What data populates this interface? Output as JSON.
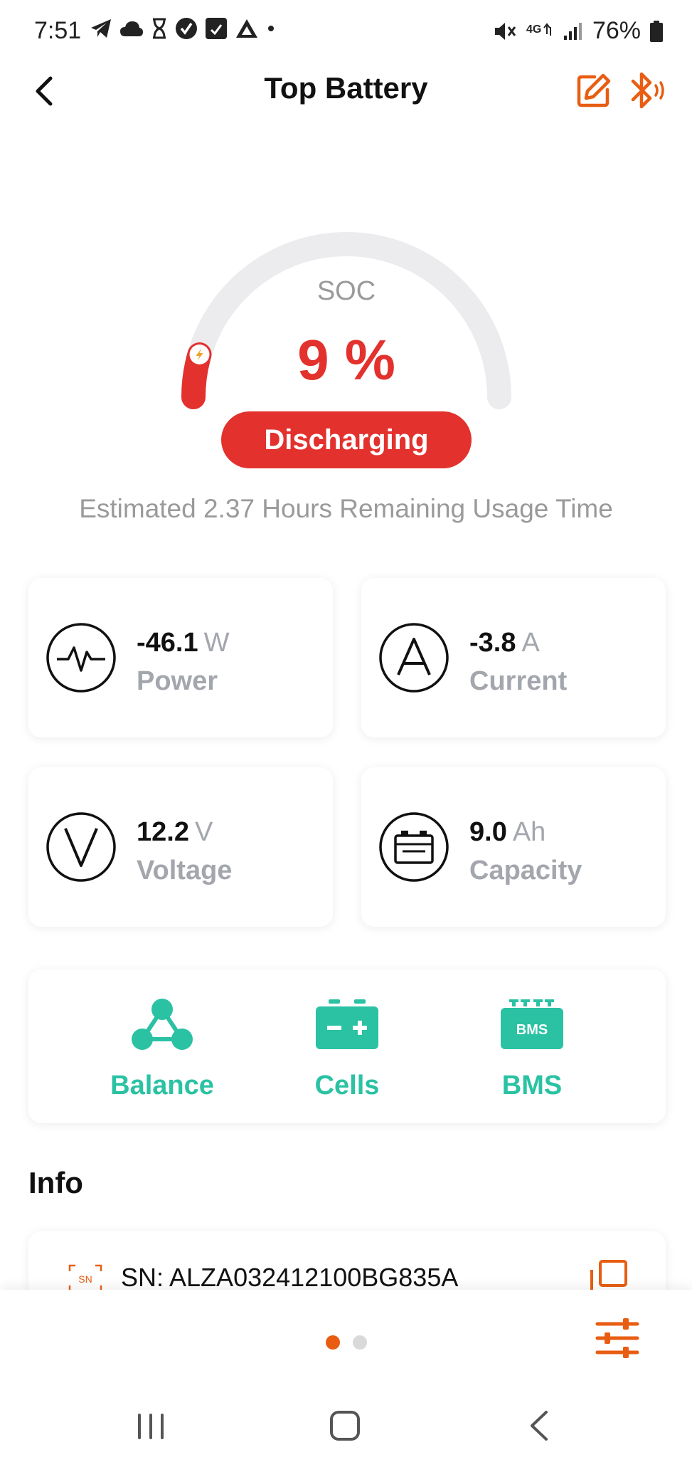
{
  "status_bar": {
    "time": "7:51",
    "battery_percent": "76%"
  },
  "header": {
    "title": "Top Battery"
  },
  "gauge": {
    "label": "SOC",
    "value": "9 %",
    "level_fraction": 0.09,
    "status": "Discharging",
    "remaining": "Estimated 2.37 Hours Remaining Usage Time"
  },
  "stats": [
    {
      "value": "-46.1",
      "unit": "W",
      "label": "Power",
      "icon": "pulse-icon"
    },
    {
      "value": "-3.8",
      "unit": "A",
      "label": "Current",
      "icon": "ampere-icon"
    },
    {
      "value": "12.2",
      "unit": "V",
      "label": "Voltage",
      "icon": "volt-icon"
    },
    {
      "value": "9.0",
      "unit": "Ah",
      "label": "Capacity",
      "icon": "battery-capacity-icon"
    }
  ],
  "actions": [
    {
      "label": "Balance",
      "icon": "balance-icon"
    },
    {
      "label": "Cells",
      "icon": "cells-icon"
    },
    {
      "label": "BMS",
      "icon": "bms-icon",
      "icon_text": "BMS"
    }
  ],
  "info": {
    "title": "Info",
    "sn_badge": "SN",
    "sn": "SN: ALZA032412100BG835A"
  },
  "pager": {
    "pages": 2,
    "active": 1
  },
  "colors": {
    "accent_orange": "#e85d12",
    "danger_red": "#e3312d",
    "teal": "#2ac2a3",
    "muted_gray": "#a3a6ad"
  }
}
